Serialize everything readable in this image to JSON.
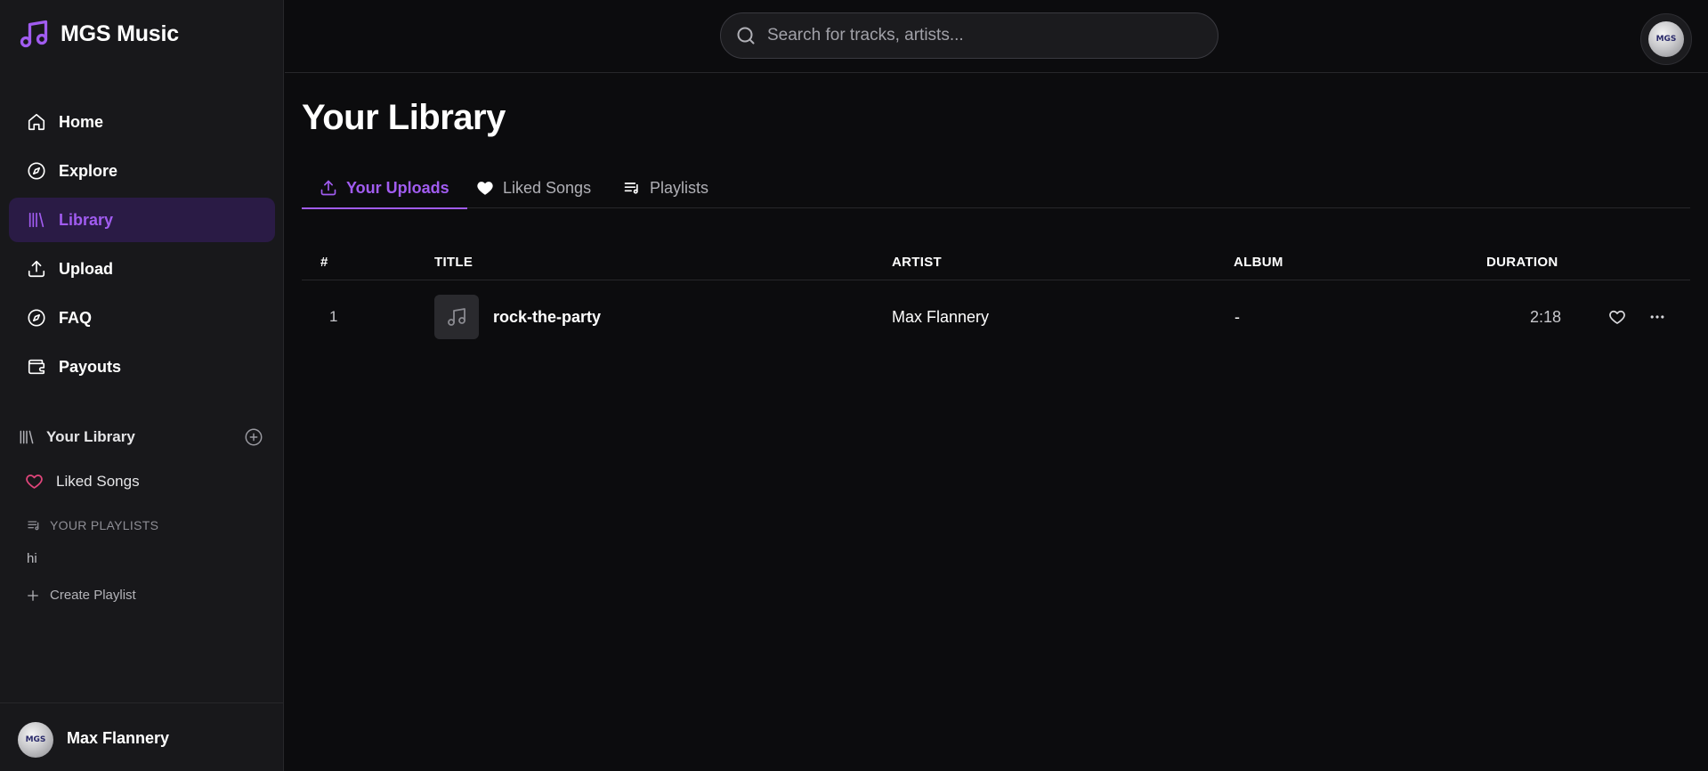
{
  "app": {
    "title": "MGS Music"
  },
  "nav": {
    "items": [
      {
        "label": "Home",
        "icon": "home-icon"
      },
      {
        "label": "Explore",
        "icon": "compass-icon"
      },
      {
        "label": "Library",
        "icon": "library-icon",
        "active": true
      },
      {
        "label": "Upload",
        "icon": "upload-icon"
      },
      {
        "label": "FAQ",
        "icon": "compass-icon"
      },
      {
        "label": "Payouts",
        "icon": "wallet-icon"
      }
    ]
  },
  "sidebar_library": {
    "title": "Your Library",
    "liked_songs": "Liked Songs",
    "playlists_heading": "YOUR PLAYLISTS",
    "playlists": [
      "hi"
    ],
    "create_playlist": "Create Playlist"
  },
  "user": {
    "name": "Max Flannery",
    "avatar_text": "MGS"
  },
  "search": {
    "placeholder": "Search for tracks, artists..."
  },
  "main": {
    "title": "Your Library",
    "tabs": [
      {
        "label": "Your Uploads",
        "icon": "upload-icon",
        "active": true
      },
      {
        "label": "Liked Songs",
        "icon": "heart-icon"
      },
      {
        "label": "Playlists",
        "icon": "playlist-icon"
      }
    ]
  },
  "table": {
    "headers": {
      "num": "#",
      "title": "TITLE",
      "artist": "ARTIST",
      "album": "ALBUM",
      "duration": "DURATION"
    },
    "rows": [
      {
        "num": "1",
        "title": "rock-the-party",
        "artist": "Max Flannery",
        "album": "-",
        "duration": "2:18"
      }
    ]
  },
  "colors": {
    "accent": "#a15cf0",
    "accent_bg": "#2a1b45",
    "heart": "#e0457b",
    "background": "#0c0c0e",
    "sidebar": "#18181b"
  }
}
